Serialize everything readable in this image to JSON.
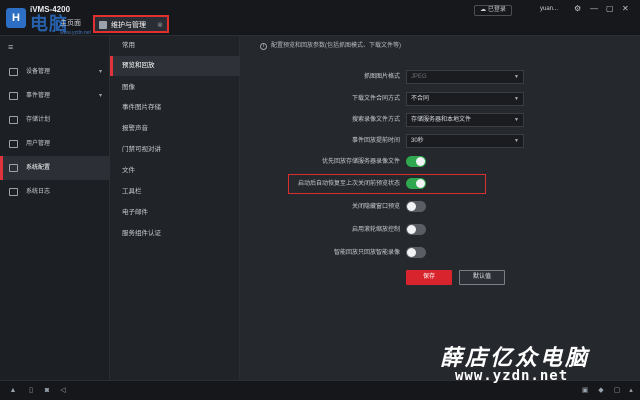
{
  "app": {
    "name": "iVMS-4200",
    "watermark_top": "电脑",
    "watermark_url": "www.yzdn.net"
  },
  "tabs": [
    {
      "label": "主页面"
    },
    {
      "label": "维护与管理",
      "close": "⊗"
    }
  ],
  "titlebar": {
    "login_label": "已登录",
    "user_name": "yuan...",
    "minimize": "—",
    "maximize": "▢",
    "close": "✕"
  },
  "sidebar": {
    "menu_icon": "≡",
    "items": [
      {
        "label": "设备管理",
        "icon": "device-icon",
        "caret": "▾"
      },
      {
        "label": "事件管理",
        "icon": "event-icon",
        "caret": "▾"
      },
      {
        "label": "存储计划",
        "icon": "storage-icon",
        "caret": ""
      },
      {
        "label": "用户管理",
        "icon": "user-icon",
        "caret": ""
      },
      {
        "label": "系统配置",
        "icon": "gear-icon",
        "caret": ""
      },
      {
        "label": "系统日志",
        "icon": "log-icon",
        "caret": ""
      }
    ]
  },
  "subnav": {
    "items": [
      {
        "label": "常用"
      },
      {
        "label": "预览和回放"
      },
      {
        "label": "图像"
      },
      {
        "label": "事件图片存储"
      },
      {
        "label": "报警声音"
      },
      {
        "label": "门禁可视对讲"
      },
      {
        "label": "文件"
      },
      {
        "label": "工具栏"
      },
      {
        "label": "电子邮件"
      },
      {
        "label": "服务组件认证"
      }
    ]
  },
  "content": {
    "hint": "配置预览和回放参数(包括抓图模式、下载文件等)",
    "selects": [
      {
        "label": "抓图图片格式",
        "value": "JPEG",
        "disabled": true
      },
      {
        "label": "下载文件合同方式",
        "value": "不合同"
      },
      {
        "label": "搜索录像文件方式",
        "value": "存储服务器和本地文件"
      },
      {
        "label": "事件回放提前时间",
        "value": "30秒"
      }
    ],
    "toggles": [
      {
        "label": "优先回放存储服务器录像文件",
        "on": true
      },
      {
        "label": "启动后自动恢复至上次关闭前预览状态",
        "on": true
      },
      {
        "label": "关闭隐藏窗口预览",
        "on": false
      },
      {
        "label": "启用滚轮缩放控制",
        "on": false
      },
      {
        "label": "智能回放只回放智能录像",
        "on": false
      }
    ],
    "save_label": "保存",
    "default_label": "默认值"
  },
  "statusbar": {
    "icons": [
      "alert-icon",
      "trash-icon",
      "camera-icon",
      "volume-icon"
    ],
    "right_icons": [
      "lock-icon",
      "speaker-icon",
      "fullscreen-icon",
      "up-icon"
    ]
  },
  "watermark": {
    "text": "薛店亿众电脑",
    "url": "www.yzdn.net"
  }
}
